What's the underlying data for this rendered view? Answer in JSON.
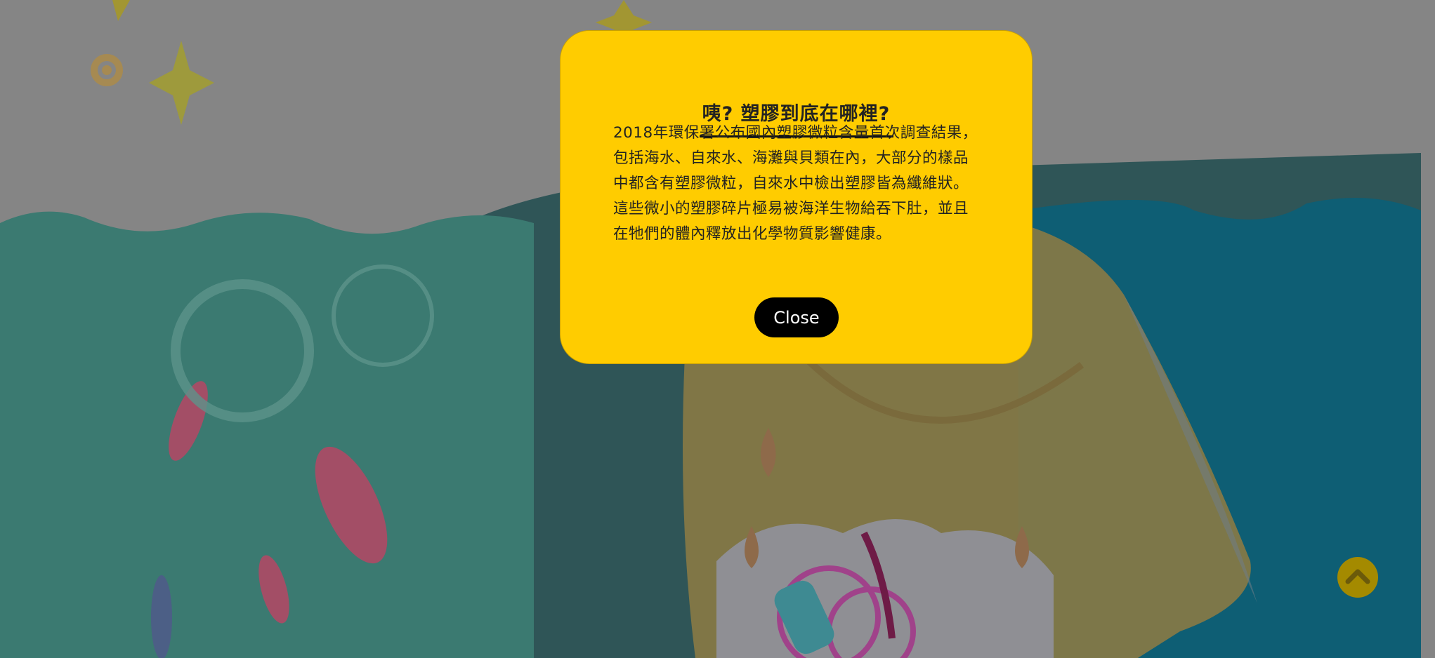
{
  "modal": {
    "title": "咦? 塑膠到底在哪裡?",
    "paragraphs": [
      "2018年環保署公布國內塑膠微粒含量首次調查結果，包括海水、自來水、海灘與貝類在內，大部分的樣品中都含有塑膠微粒，自來水中檢出塑膠皆為纖維狀。",
      "這些微小的塑膠碎片極易被海洋生物給吞下肚，並且在牠們的體內釋放出化學物質影響健康。"
    ],
    "close_label": "Close"
  },
  "back_to_top": {
    "icon": "chevron-up-icon"
  },
  "colors": {
    "modal_bg": "#ffcc00",
    "overlay": "#8a8a8a",
    "sea": "#3a7a72",
    "sea_deep": "#0e5f78",
    "back_to_top": "#a48a00"
  }
}
